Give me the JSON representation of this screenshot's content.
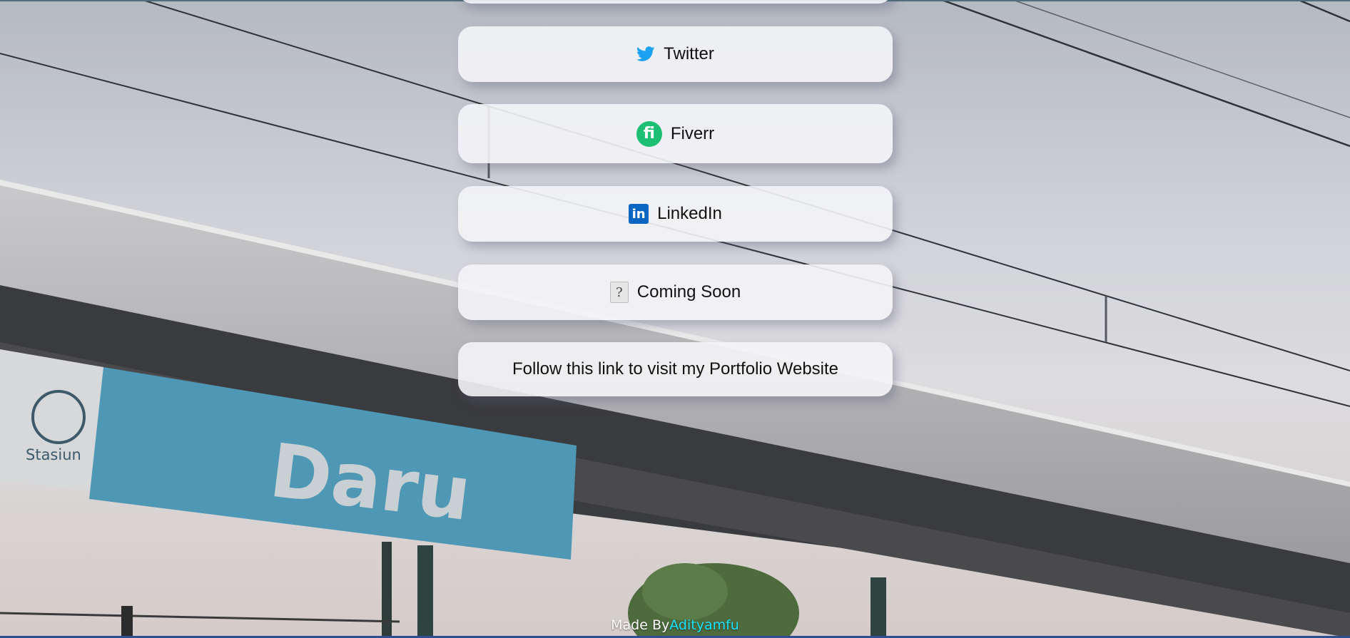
{
  "links": [
    {
      "id": "twitter",
      "label": "Twitter",
      "icon": "twitter-bird-icon"
    },
    {
      "id": "fiverr",
      "label": "Fiverr",
      "icon": "fiverr-logo-icon",
      "icon_text": "fi"
    },
    {
      "id": "linkedin",
      "label": "LinkedIn",
      "icon": "linkedin-logo-icon",
      "icon_text": "in"
    },
    {
      "id": "coming-soon",
      "label": "Coming Soon",
      "icon": "question-mark-icon",
      "icon_text": "?"
    },
    {
      "id": "portfolio",
      "label": "Follow this link to visit my Portfolio Website"
    }
  ],
  "background": {
    "sign_station_word": "Stasiun",
    "sign_name": "Daru"
  },
  "footer": {
    "prefix": "Made By",
    "author": "Adityamfu"
  },
  "colors": {
    "twitter": "#1da1f2",
    "fiverr": "#1dbf73",
    "linkedin": "#0a66c2",
    "footer_author": "#18e3ff",
    "button_bg": "#f4f4f7"
  }
}
